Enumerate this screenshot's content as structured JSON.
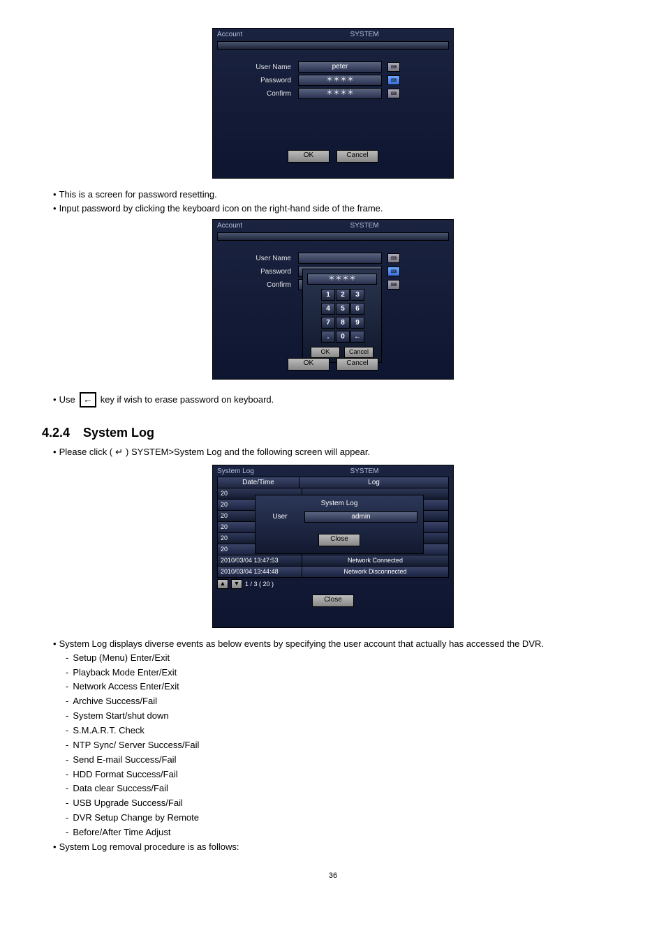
{
  "account_dialog1": {
    "title_left": "Account",
    "title_center": "SYSTEM",
    "username_label": "User Name",
    "password_label": "Password",
    "confirm_label": "Confirm",
    "username_value": "peter",
    "password_value": "＊＊＊＊",
    "confirm_value": "＊＊＊＊",
    "ok": "OK",
    "cancel": "Cancel"
  },
  "text1": "This is a screen for password resetting.",
  "text2": "Input password by clicking the keyboard icon on the right-hand side of the frame.",
  "account_dialog2": {
    "title_left": "Account",
    "title_center": "SYSTEM",
    "username_label": "User Name",
    "password_label": "Password",
    "confirm_label": "Confirm",
    "keypad_value": "＊＊＊＊",
    "keys": [
      "1",
      "2",
      "3",
      "4",
      "5",
      "6",
      "7",
      "8",
      "9",
      ".",
      "0",
      "←"
    ],
    "kp_ok": "OK",
    "kp_cancel": "Cancel",
    "ok": "OK",
    "cancel": "Cancel"
  },
  "text3a": "Use",
  "text3b": "key if wish to erase password on keyboard.",
  "back_glyph": "←",
  "section": {
    "num": "4.2.4",
    "title": "System Log"
  },
  "text4a": "Please click (",
  "text4_icon": "↵",
  "text4b": ") SYSTEM>System Log and the following screen will appear.",
  "syslog": {
    "title_left": "System Log",
    "title_center": "SYSTEM",
    "col_date": "Date/Time",
    "col_log": "Log",
    "rows": [
      {
        "dt": "20",
        "log": ""
      },
      {
        "dt": "20",
        "log": ""
      },
      {
        "dt": "20",
        "log": ""
      },
      {
        "dt": "20",
        "log": ""
      },
      {
        "dt": "20",
        "log": ""
      },
      {
        "dt": "20",
        "log": ""
      },
      {
        "dt": "2010/03/04 13:47:53",
        "log": "Network Connected"
      },
      {
        "dt": "2010/03/04 13:44:48",
        "log": "Network Disconnected"
      }
    ],
    "pager": "1 / 3 ( 20 )",
    "up": "▲",
    "down": "▼",
    "close": "Close",
    "popup": {
      "title": "System Log",
      "user_label": "User",
      "user_value": "admin",
      "close": "Close"
    }
  },
  "text5": "System Log displays diverse events as below events by specifying the user account that actually has accessed the DVR.",
  "events": [
    "Setup (Menu) Enter/Exit",
    "Playback Mode Enter/Exit",
    "Network Access Enter/Exit",
    "Archive Success/Fail",
    "System Start/shut down",
    "S.M.A.R.T. Check",
    "NTP Sync/ Server Success/Fail",
    "Send E-mail Success/Fail",
    "HDD Format Success/Fail",
    "Data clear Success/Fail",
    "USB Upgrade Success/Fail",
    "DVR Setup Change by Remote",
    "Before/After Time Adjust"
  ],
  "text6": "System Log removal procedure is as follows:",
  "page_number": "36"
}
